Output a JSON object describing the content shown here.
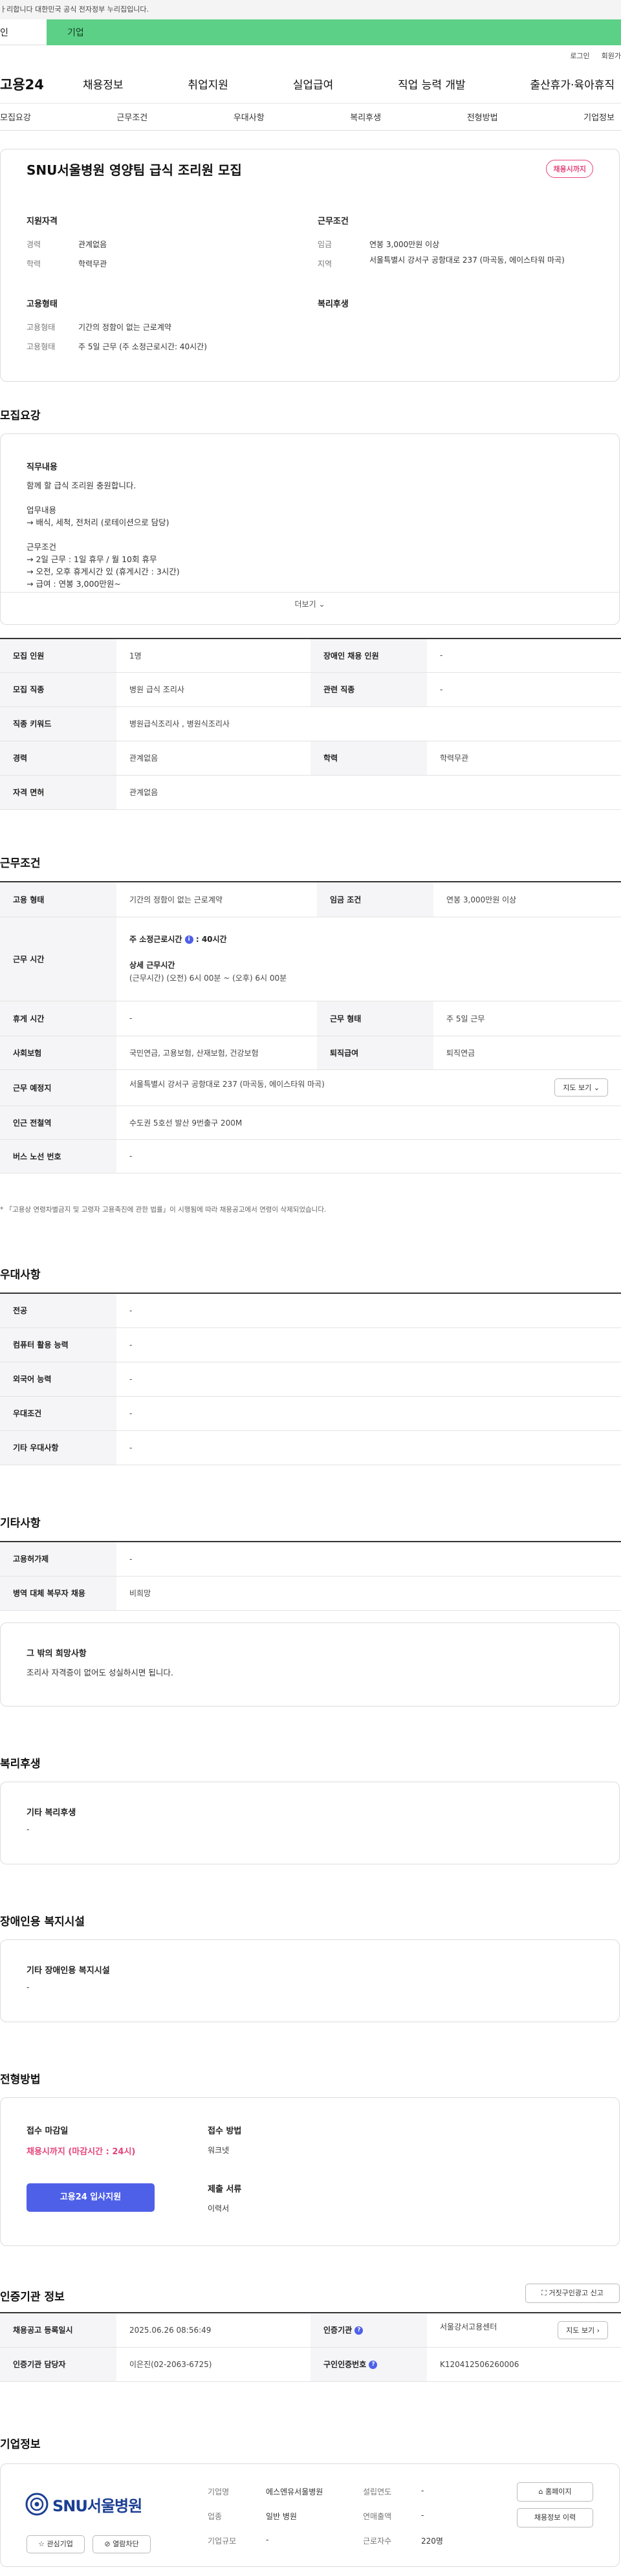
{
  "gov_banner": "ㅏ리합니다 대한민국 공식 전자정부 누리집입니다.",
  "user_tabs": {
    "person": "인",
    "company": "기업"
  },
  "util": {
    "login": "로그인",
    "signup": "회원가"
  },
  "gnb": {
    "logo": "고용24",
    "menu": [
      "채용정보",
      "취업지원",
      "실업급여",
      "직업 능력 개발",
      "출산휴가·육아휴직"
    ]
  },
  "subtabs": [
    "모집요강",
    "근무조건",
    "우대사항",
    "복리후생",
    "전형방법",
    "기업정보"
  ],
  "summary": {
    "title": "SNU서울병원 영양팀 급식 조리원 모집",
    "badge": "채용시까지",
    "qual_title": "지원자격",
    "career_k": "경력",
    "career_v": "관계없음",
    "edu_k": "학력",
    "edu_v": "학력무관",
    "work_title": "근무조건",
    "wage_k": "임금",
    "wage_v": "연봉 3,000만원 이상",
    "region_k": "지역",
    "region_v": "서울특별시 강서구 공항대로 237 (마곡동, 에이스타워 마곡)",
    "emp_title": "고용형태",
    "emp_k1": "고용형태",
    "emp_v1": "기간의 정함이 없는 근로계약",
    "emp_k2": "고용형태",
    "emp_v2": "주 5일 근무 (주 소정근로시간: 40시간)",
    "welfare_title": "복리후생"
  },
  "recruit": {
    "section": "모집요강",
    "duty_title": "직무내용",
    "lines": [
      "함께 할 급식  조리원 충원합니다.",
      "",
      "업무내용",
      "→ 배식, 세척, 전처리 (로테이션으로 담당)",
      "",
      "근무조건",
      "→ 2일 근무 : 1일 휴무 / 월 10회 휴무",
      "→ 오전, 오후 휴게시간 있 (휴게시간 : 3시간)",
      "→ 급여 : 연봉 3,000만원~"
    ],
    "more": "더보기",
    "table": {
      "count_h": "모집 인원",
      "count_v": "1명",
      "disabled_h": "장애인 채용 인원",
      "disabled_v": "-",
      "job_h": "모집 직종",
      "job_v": "병원 급식 조리사",
      "related_h": "관련 직종",
      "related_v": "-",
      "keyword_h": "직종 키워드",
      "keyword_v": "병원급식조리사 , 병원식조리사",
      "career_h": "경력",
      "career_v": "관계없음",
      "edu_h": "학력",
      "edu_v": "학력무관",
      "license_h": "자격 면허",
      "license_v": "관계없음"
    }
  },
  "conditions": {
    "section": "근무조건",
    "emp_h": "고용 형태",
    "emp_v": "기간의 정함이 없는 근로계약",
    "wage_h": "임금 조건",
    "wage_v": "연봉 3,000만원 이상",
    "hours_h": "근무 시간",
    "weekly_label": "주 소정근로시간",
    "weekly_value": ": 40시간",
    "detail_label": "상세 근무시간",
    "detail_value": "(근무시간) (오전) 6시 00분 ~ (오후) 6시 00분",
    "break_h": "휴게 시간",
    "break_v": "-",
    "form_h": "근무 형태",
    "form_v": "주 5일 근무",
    "ins_h": "사회보험",
    "ins_v": "국민연금, 고용보험, 산재보험, 건강보험",
    "sev_h": "퇴직급여",
    "sev_v": "퇴직연금",
    "place_h": "근무 예정지",
    "place_v": "서울특별시 강서구 공항대로 237 (마곡동, 에이스타워 마곡)",
    "map_btn": "지도 보기",
    "station_h": "인근 전철역",
    "station_v": "수도권 5호선 발산 9번출구 200M",
    "bus_h": "버스 노선 번호",
    "bus_v": "-",
    "note": "* 「고용상 연령차별금지 및 고령자 고용촉진에 관한 법률」이 시행됨에 따라 채용공고에서 연령이 삭제되었습니다."
  },
  "pref": {
    "section": "우대사항",
    "rows": [
      {
        "h": "전공",
        "v": "-"
      },
      {
        "h": "컴퓨터 활용 능력",
        "v": "-"
      },
      {
        "h": "외국어 능력",
        "v": "-"
      },
      {
        "h": "우대조건",
        "v": "-"
      },
      {
        "h": "기타 우대사항",
        "v": "-"
      }
    ]
  },
  "etc": {
    "section": "기타사항",
    "rows": [
      {
        "h": "고용허가제",
        "v": "-"
      },
      {
        "h": "병역 대체 복무자 채용",
        "v": "비희망"
      }
    ],
    "other_title": "그 밖의 희망사항",
    "other_text": "조리사 자격증이 없어도 성실하시면 됩니다."
  },
  "welfare": {
    "section": "복리후생",
    "title": "기타 복리후생",
    "text": "-"
  },
  "facility": {
    "section": "장애인용 복지시설",
    "title": "기타 장애인용 복지시설",
    "text": "-"
  },
  "process": {
    "section": "전형방법",
    "deadline_title": "접수 마감일",
    "deadline_value": "채용시까지 (마감시간 : 24시)",
    "apply_btn": "고용24 입사지원",
    "method_title": "접수 방법",
    "method_value": "워크넷",
    "docs_title": "제출 서류",
    "docs_value": "이력서"
  },
  "auth": {
    "section": "인증기관 정보",
    "report_btn": "거짓구인광고 신고",
    "date_h": "채용공고 등록일시",
    "date_v": "2025.06.26 08:56:49",
    "org_h": "인증기관",
    "org_v": "서울강서고용센터",
    "map_btn": "지도 보기",
    "mgr_h": "인증기관 담당자",
    "mgr_v": "이은진(02-2063-6725)",
    "no_h": "구인인증번호",
    "no_v": "K120412506260006"
  },
  "company": {
    "section": "기업정보",
    "logo_text": "SNU서울병원",
    "fav_btn": "관심기업",
    "block_btn": "열람차단",
    "name_k": "기업명",
    "name_v": "에스엔유서울병원",
    "year_k": "설립연도",
    "year_v": "-",
    "ind_k": "업종",
    "ind_v": "일반 병원",
    "sales_k": "연매출액",
    "sales_v": "-",
    "size_k": "기업규모",
    "size_v": "-",
    "emp_k": "근로자수",
    "emp_v": "220명",
    "home_btn": "홈페이지",
    "history_btn": "채용정보 이력"
  }
}
